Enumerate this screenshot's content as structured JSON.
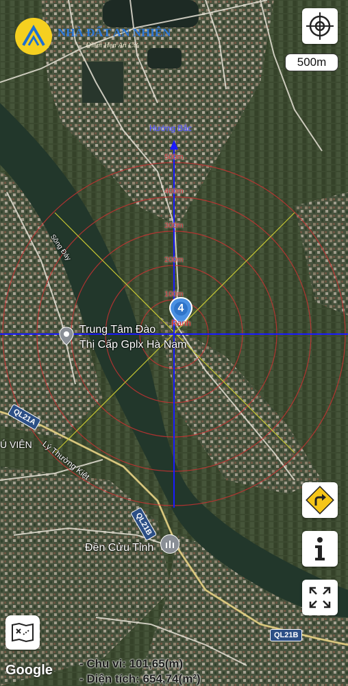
{
  "brand": {
    "name": "NHÀ ĐẤT AN NHIÊN",
    "tagline": "Điểm Hẹn An Cư"
  },
  "scale": {
    "label": "500m"
  },
  "compass": {
    "north_label": "Hướng Bắc"
  },
  "distance_rings": [
    "500m",
    "400m",
    "300m",
    "200m",
    "100m"
  ],
  "marker": {
    "count": "4",
    "label": "Ranh"
  },
  "places": {
    "poi_name_line1": "Trung Tâm Đào",
    "poi_name_line2": "Thị Cấp Gplx Hà Nam",
    "temple": "Đền Cửu Tỉnh",
    "river": "Sông Đáy",
    "street": "Lý Thường Kiệt",
    "area": "Ú VIÊN"
  },
  "roads": {
    "ql21a": "QL21A",
    "ql21b_a": "QL21B",
    "ql21b_b": "QL21B"
  },
  "measure": {
    "perimeter": "- Chu vi: 101,65(m)",
    "area": "- Diện tích: 654,74(m²)"
  },
  "attribution": "Google",
  "buttons": {
    "locate": "locate-icon",
    "directions": "turn-right-arrow-icon",
    "info": "info-icon",
    "fullscreen": "expand-icon",
    "map_type": "map-type-icon"
  },
  "colors": {
    "axis": "#1a1aff",
    "ring": "#c83232",
    "boundary": "#c8c832",
    "river": "#22372b"
  }
}
